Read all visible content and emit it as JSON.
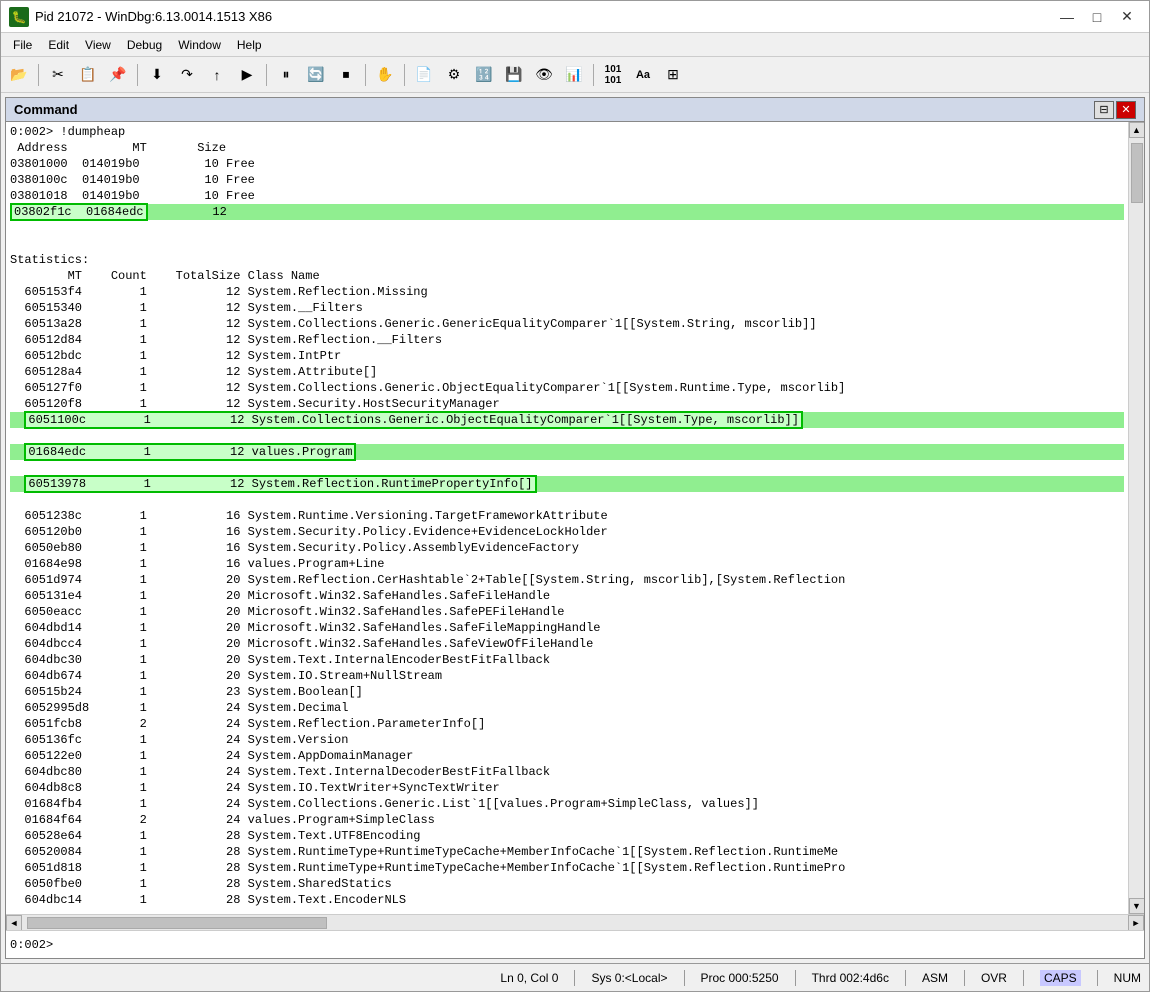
{
  "window": {
    "title": "Pid 21072 - WinDbg:6.13.0014.1513 X86",
    "icon": "🐛"
  },
  "titlebar": {
    "minimize": "—",
    "maximize": "□",
    "close": "✕"
  },
  "menubar": {
    "items": [
      "File",
      "Edit",
      "View",
      "Debug",
      "Window",
      "Help"
    ]
  },
  "panel": {
    "title": "Command",
    "close_btn": "✕",
    "pin_btn": "⊟"
  },
  "output": {
    "lines": [
      "0:002> !dumpheap",
      " Address         MT       Size",
      "03801000  014019b0         10 Free",
      "0380100c  014019b0         10 Free",
      "03801018  014019b0         10 Free",
      "03802f1c  01684edc         12",
      "",
      "Statistics:",
      "        MT    Count    TotalSize Class Name",
      "  605153f4        1           12 System.Reflection.Missing",
      "  60515340        1           12 System.__Filters",
      "  60513a28        1           12 System.Collections.Generic.GenericEqualityComparer`1[[System.String, mscorlib]]",
      "  60512d84        1           12 System.Reflection.__Filters",
      "  60512bdc        1           12 System.IntPtr",
      "  605128a4        1           12 System.Attribute[]",
      "  605127f0        1           12 System.Collections.Generic.ObjectEqualityComparer`1[[System.Runtime.Type, mscorlib]",
      "  605120f8        1           12 System.Security.HostSecurityManager",
      "  6051100c        1           12 System.Collections.Generic.ObjectEqualityComparer`1[[System.Type, mscorlib]]",
      "  01684edc        1           12 values.Program",
      "  60513978        1           12 System.Reflection.RuntimePropertyInfo[]",
      "  6051238c        1           16 System.Runtime.Versioning.TargetFrameworkAttribute",
      "  605120b0        1           16 System.Security.Policy.Evidence+EvidenceLockHolder",
      "  6050eb80        1           16 System.Security.Policy.AssemblyEvidenceFactory",
      "  01684e98        1           16 values.Program+Line",
      "  6051d974        1           20 System.Reflection.CerHashtable`2+Table[[System.String, mscorlib],[System.Reflectio",
      "  605131e4        1           20 Microsoft.Win32.SafeHandles.SafeFileHandle",
      "  6050eacc        1           20 Microsoft.Win32.SafeHandles.SafePEFileHandle",
      "  604dbd14        1           20 Microsoft.Win32.SafeHandles.SafeFileMappingHandle",
      "  604dbcc4        1           20 Microsoft.Win32.SafeHandles.SafeViewOfFileHandle",
      "  604dbc30        1           20 System.Text.InternalEncoderBestFitFallback",
      "  604db674        1           20 System.IO.Stream+NullStream",
      "  60515b24        1           23 System.Boolean[]",
      "  6052995d8       1           24 System.Decimal",
      "  6051fcb8        2           24 System.Reflection.ParameterInfo[]",
      "  605136fc        1           24 System.Version",
      "  605122e0        1           24 System.AppDomainManager",
      "  604dbc80        1           24 System.Text.InternalDecoderBestFitFallback",
      "  604db8c8        1           24 System.IO.TextWriter+SyncTextWriter",
      "  01684fb4        1           24 System.Collections.Generic.List`1[[values.Program+SimpleClass, values]]",
      "  01684f64        2           24 values.Program+SimpleClass",
      "  60528e64        1           28 System.Text.UTF8Encoding",
      "  60520084        1           28 System.RuntimeType+RuntimeTypeCache+MemberInfoCache`1[[System.Reflection.RuntimeMe",
      "  6051d818        1           28 System.RuntimeType+RuntimeTypeCache+MemberInfoCache`1[[System.Reflection.RuntimePro",
      "  6050fbe0        1           28 System.SharedStatics",
      "  604dbc14        1           28 System.Text.EncoderNLS"
    ],
    "highlight_rows": [
      5,
      18,
      19,
      20
    ]
  },
  "input": {
    "prompt": "0:002>",
    "value": ""
  },
  "statusbar": {
    "ln_col": "Ln 0, Col 0",
    "sys": "Sys 0:<Local>",
    "proc": "Proc 000:5250",
    "thrd": "Thrd 002:4d6c",
    "asm": "ASM",
    "ovr": "OVR",
    "caps": "CAPS",
    "num": "NUM"
  }
}
